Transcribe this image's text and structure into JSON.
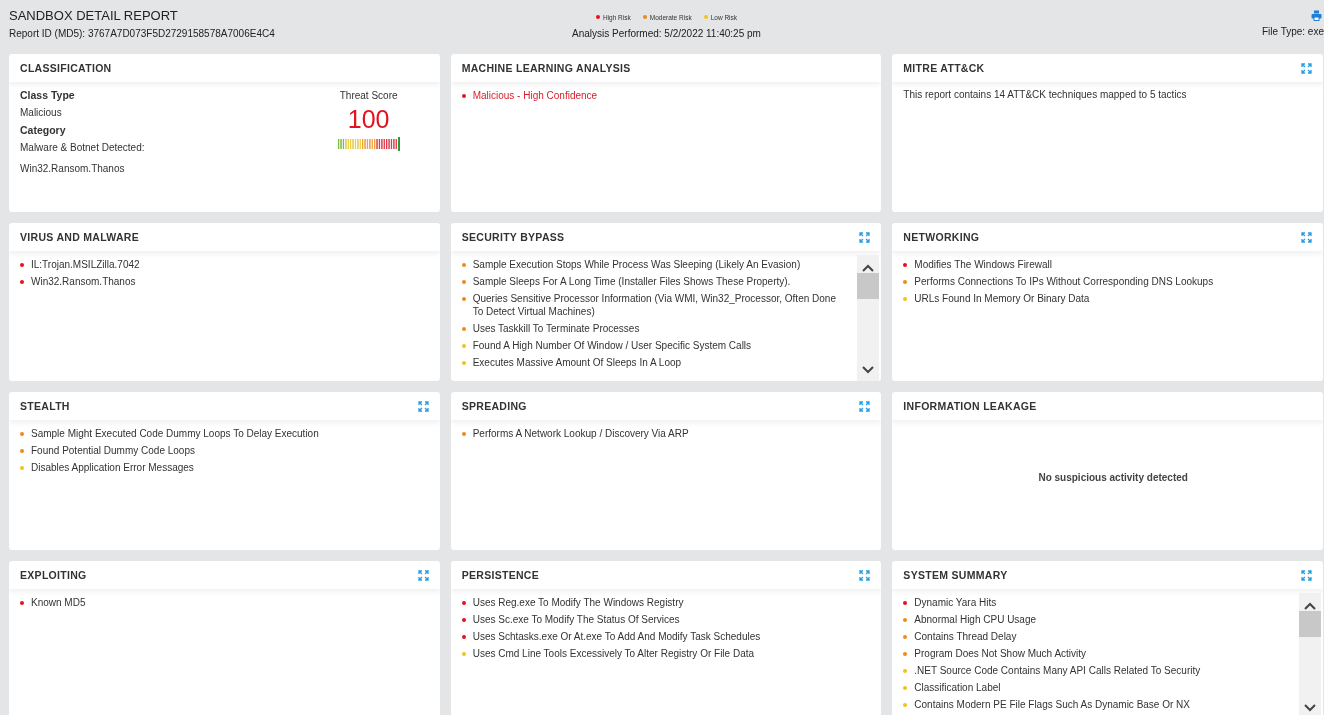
{
  "header": {
    "title": "SANDBOX DETAIL REPORT",
    "report_id": "Report ID (MD5): 3767A7D073F5D2729158578A7006E4C4",
    "analysis": "Analysis Performed: 5/2/2022 11:40:25 pm",
    "file_type": "File Type: exe",
    "legend": [
      {
        "label": "High Risk",
        "color": "#e3121f"
      },
      {
        "label": "Moderate Risk",
        "color": "#f08a16"
      },
      {
        "label": "Low Risk",
        "color": "#f4c21c"
      }
    ]
  },
  "cards": [
    {
      "kind": "classification",
      "title": "CLASSIFICATION",
      "expandable": false,
      "fields": [
        {
          "label": "Class Type",
          "value": "Malicious"
        },
        {
          "label": "Category",
          "value": "Malware & Botnet Detected:",
          "value2": "Win32.Ransom.Thanos"
        }
      ],
      "threat": {
        "label": "Threat Score",
        "score": "100"
      }
    },
    {
      "kind": "list",
      "title": "MACHINE LEARNING ANALYSIS",
      "expandable": false,
      "scrollable": false,
      "tinted": true,
      "items": [
        {
          "text": "Malicious - High Confidence",
          "color": "#e3121f"
        }
      ]
    },
    {
      "kind": "message",
      "title": "MITRE ATT&CK",
      "expandable": true,
      "text": "This report contains 14 ATT&CK techniques mapped to 5 tactics"
    },
    {
      "kind": "list",
      "title": "VIRUS AND MALWARE",
      "expandable": false,
      "scrollable": false,
      "items": [
        {
          "text": "IL:Trojan.MSILZilla.7042",
          "color": "#e3121f"
        },
        {
          "text": "Win32.Ransom.Thanos",
          "color": "#e3121f"
        }
      ]
    },
    {
      "kind": "list",
      "title": "SECURITY BYPASS",
      "expandable": true,
      "scrollable": true,
      "items": [
        {
          "text": "Sample Execution Stops While Process Was Sleeping (Likely An Evasion)",
          "color": "#f08a16"
        },
        {
          "text": "Sample Sleeps For A Long Time (Installer Files Shows These Property).",
          "color": "#f08a16"
        },
        {
          "text": "Queries Sensitive Processor Information (Via WMI, Win32_Processor, Often Done To Detect Virtual Machines)",
          "color": "#f08a16"
        },
        {
          "text": "Uses Taskkill To Terminate Processes",
          "color": "#f08a16"
        },
        {
          "text": "Found A High Number Of Window / User Specific System Calls",
          "color": "#f4c21c"
        },
        {
          "text": "Executes Massive Amount Of Sleeps In A Loop",
          "color": "#f4c21c"
        }
      ]
    },
    {
      "kind": "list",
      "title": "NETWORKING",
      "expandable": true,
      "scrollable": false,
      "items": [
        {
          "text": "Modifies The Windows Firewall",
          "color": "#e3121f"
        },
        {
          "text": "Performs Connections To IPs Without Corresponding DNS Lookups",
          "color": "#f08a16"
        },
        {
          "text": "URLs Found In Memory Or Binary Data",
          "color": "#f4c21c"
        }
      ]
    },
    {
      "kind": "list",
      "title": "STEALTH",
      "expandable": true,
      "scrollable": false,
      "items": [
        {
          "text": "Sample Might Executed Code Dummy Loops To Delay Execution",
          "color": "#f08a16"
        },
        {
          "text": "Found Potential Dummy Code Loops",
          "color": "#f08a16"
        },
        {
          "text": "Disables Application Error Messages",
          "color": "#f4c21c"
        }
      ]
    },
    {
      "kind": "list",
      "title": "SPREADING",
      "expandable": true,
      "scrollable": false,
      "items": [
        {
          "text": "Performs A Network Lookup / Discovery Via ARP",
          "color": "#f08a16"
        }
      ]
    },
    {
      "kind": "empty",
      "title": "INFORMATION LEAKAGE",
      "expandable": false,
      "text": "No suspicious activity detected"
    },
    {
      "kind": "list",
      "title": "EXPLOITING",
      "expandable": true,
      "scrollable": false,
      "items": [
        {
          "text": "Known MD5",
          "color": "#e3121f"
        }
      ]
    },
    {
      "kind": "list",
      "title": "PERSISTENCE",
      "expandable": true,
      "scrollable": false,
      "items": [
        {
          "text": "Uses Reg.exe To Modify The Windows Registry",
          "color": "#e3121f"
        },
        {
          "text": "Uses Sc.exe To Modify The Status Of Services",
          "color": "#e3121f"
        },
        {
          "text": "Uses Schtasks.exe Or At.exe To Add And Modify Task Schedules",
          "color": "#e3121f"
        },
        {
          "text": "Uses Cmd Line Tools Excessively To Alter Registry Or File Data",
          "color": "#f4c21c"
        }
      ]
    },
    {
      "kind": "list",
      "title": "SYSTEM SUMMARY",
      "expandable": true,
      "scrollable": true,
      "items": [
        {
          "text": "Dynamic Yara Hits",
          "color": "#e3121f"
        },
        {
          "text": "Abnormal High CPU Usage",
          "color": "#f08a16"
        },
        {
          "text": "Contains Thread Delay",
          "color": "#f08a16"
        },
        {
          "text": "Program Does Not Show Much Activity",
          "color": "#f08a16"
        },
        {
          "text": ".NET Source Code Contains Many API Calls Related To Security",
          "color": "#f4c21c"
        },
        {
          "text": "Classification Label",
          "color": "#f4c21c"
        },
        {
          "text": "Contains Modern PE File Flags Such As Dynamic Base Or NX",
          "color": "#f4c21c"
        }
      ]
    }
  ]
}
